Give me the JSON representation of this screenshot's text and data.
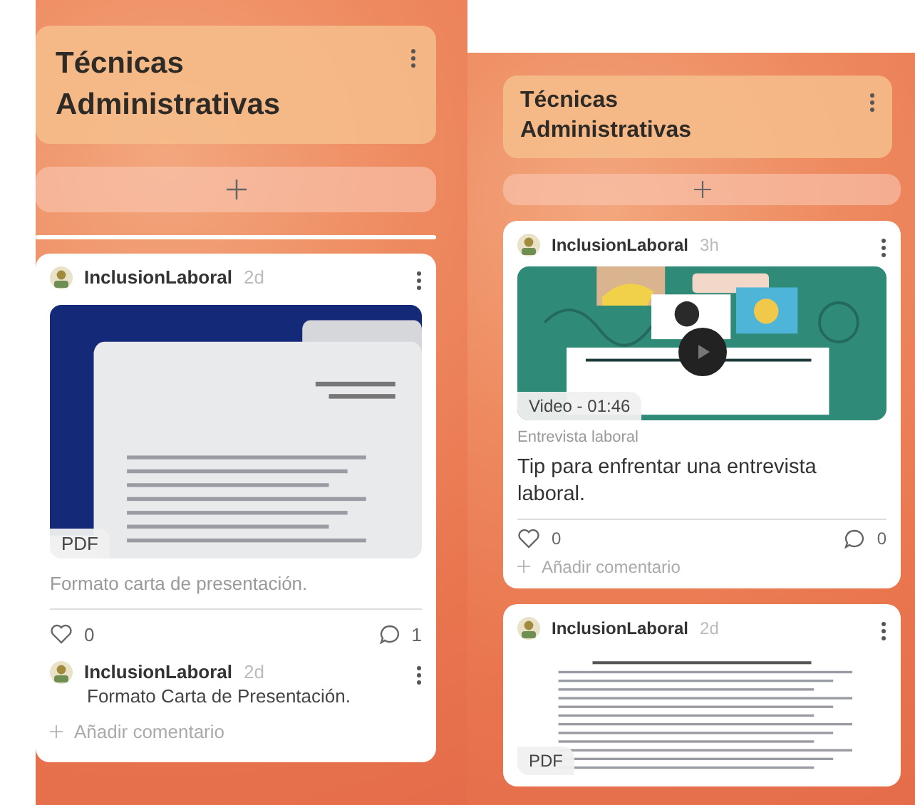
{
  "columns": [
    {
      "title": "Técnicas Administrativas",
      "posts": [
        {
          "author": "InclusionLaboral",
          "age": "2d",
          "attachment": {
            "kind": "pdf",
            "label": "PDF"
          },
          "caption": "Formato carta de presentación.",
          "likes": "0",
          "comment_count": "1",
          "comments": [
            {
              "author": "InclusionLaboral",
              "age": "2d",
              "text": "Formato Carta de Presentación."
            }
          ],
          "add_comment": "Añadir comentario"
        }
      ]
    },
    {
      "title": "Técnicas Administrativas",
      "posts": [
        {
          "author": "InclusionLaboral",
          "age": "3h",
          "attachment": {
            "kind": "video",
            "label": "Video - 01:46"
          },
          "caption": "Entrevista laboral",
          "body": "Tip para enfrentar una entrevista laboral.",
          "likes": "0",
          "comment_count": "0",
          "add_comment": "Añadir comentario"
        },
        {
          "author": "InclusionLaboral",
          "age": "2d",
          "attachment": {
            "kind": "document",
            "label": "PDF"
          }
        }
      ]
    }
  ]
}
